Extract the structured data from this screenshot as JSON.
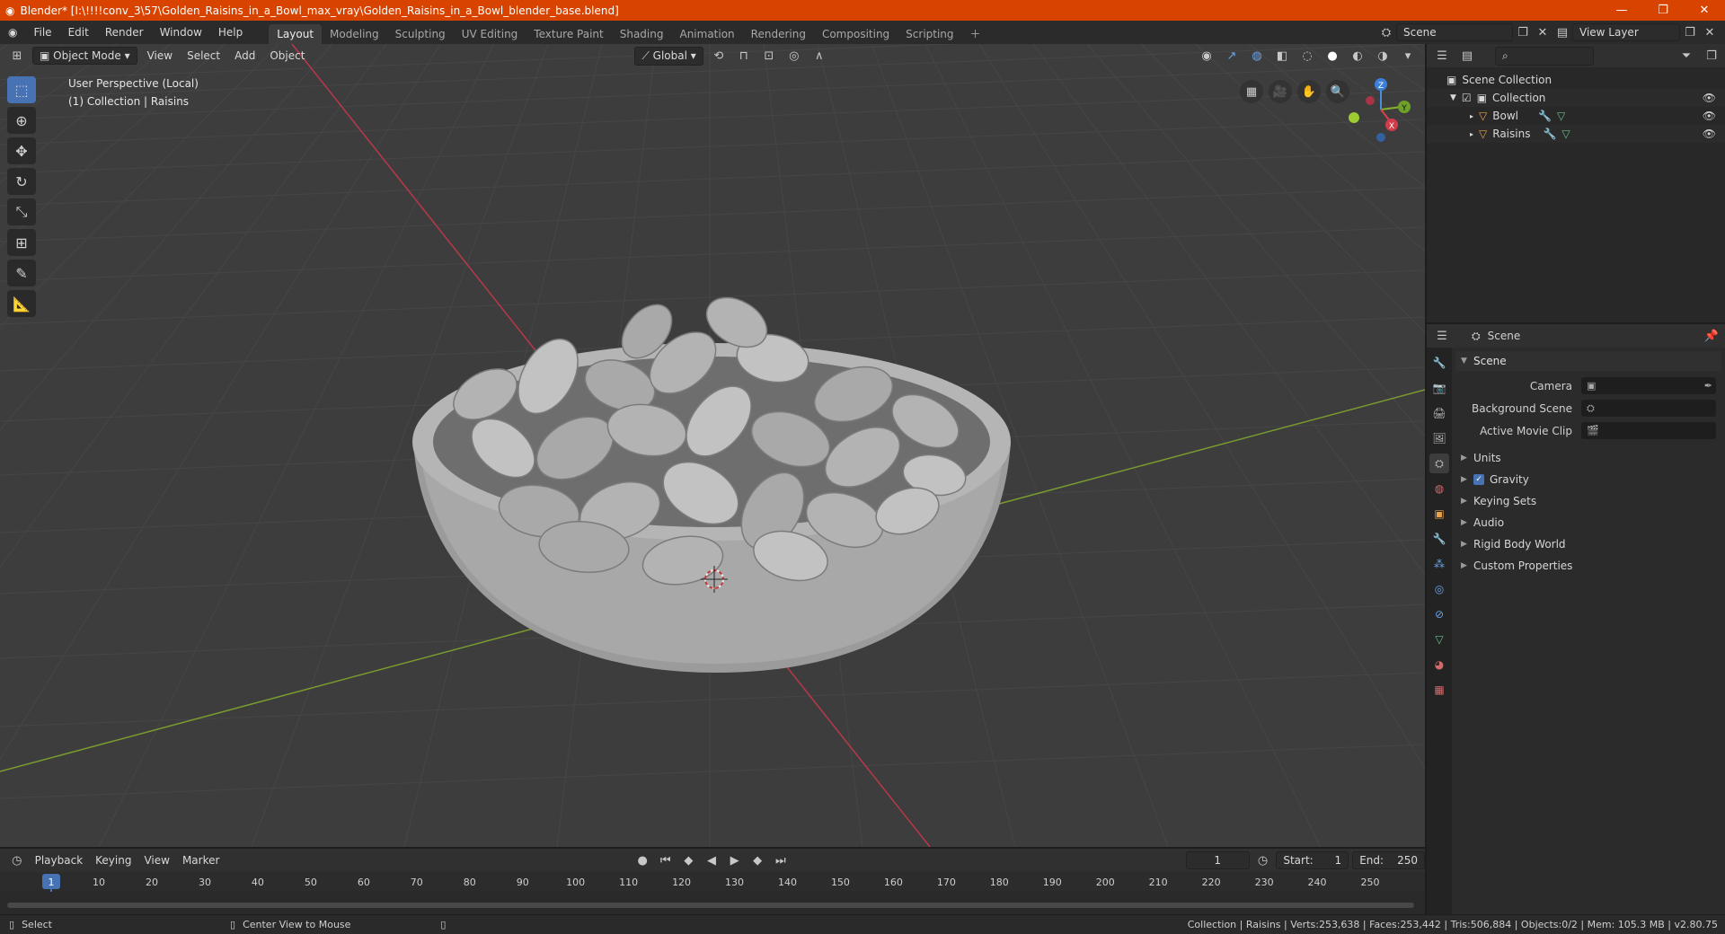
{
  "window": {
    "title": "Blender* [I:\\!!!!conv_3\\57\\Golden_Raisins_in_a_Bowl_max_vray\\Golden_Raisins_in_a_Bowl_blender_base.blend]"
  },
  "menus": [
    "File",
    "Edit",
    "Render",
    "Window",
    "Help"
  ],
  "workspaces": [
    "Layout",
    "Modeling",
    "Sculpting",
    "UV Editing",
    "Texture Paint",
    "Shading",
    "Animation",
    "Rendering",
    "Compositing",
    "Scripting"
  ],
  "active_workspace": "Layout",
  "scene_selector": {
    "label": "Scene"
  },
  "view_layer": {
    "label": "View Layer"
  },
  "viewport": {
    "mode": "Object Mode",
    "menus": [
      "View",
      "Select",
      "Add",
      "Object"
    ],
    "transform_orientation": "Global",
    "info_line1": "User Perspective (Local)",
    "info_line2": "(1) Collection | Raisins",
    "gizmo_axes": {
      "z": "Z",
      "y": "Y",
      "x": "X"
    },
    "colors": {
      "x_axis": "#b8394a",
      "y_axis": "#7a9b2f",
      "grid": "#464646",
      "background": "#3d3d3d",
      "mesh": "#bfbfbf"
    }
  },
  "outliner": {
    "root": "Scene Collection",
    "collection": "Collection",
    "items": [
      {
        "label": "Bowl"
      },
      {
        "label": "Raisins"
      }
    ]
  },
  "properties": {
    "header": "Scene",
    "panel_title": "Scene",
    "fields": [
      {
        "label": "Camera",
        "value": ""
      },
      {
        "label": "Background Scene",
        "value": ""
      },
      {
        "label": "Active Movie Clip",
        "value": ""
      }
    ],
    "subpanels": [
      {
        "label": "Units",
        "checkbox": false
      },
      {
        "label": "Gravity",
        "checkbox": true
      },
      {
        "label": "Keying Sets",
        "checkbox": false
      },
      {
        "label": "Audio",
        "checkbox": false
      },
      {
        "label": "Rigid Body World",
        "checkbox": false
      },
      {
        "label": "Custom Properties",
        "checkbox": false
      }
    ]
  },
  "timeline": {
    "menus": [
      "Playback",
      "Keying",
      "View",
      "Marker"
    ],
    "current_frame": "1",
    "start_label": "Start:",
    "start": "1",
    "end_label": "End:",
    "end": "250",
    "ticks": [
      1,
      10,
      20,
      30,
      40,
      50,
      60,
      70,
      80,
      90,
      100,
      110,
      120,
      130,
      140,
      150,
      160,
      170,
      180,
      190,
      200,
      210,
      220,
      230,
      240,
      250
    ]
  },
  "statusbar": {
    "left1": "Select",
    "left2": "Center View to Mouse",
    "right": "Collection | Raisins | Verts:253,638 | Faces:253,442 | Tris:506,884 | Objects:0/2 | Mem: 105.3 MB | v2.80.75"
  }
}
